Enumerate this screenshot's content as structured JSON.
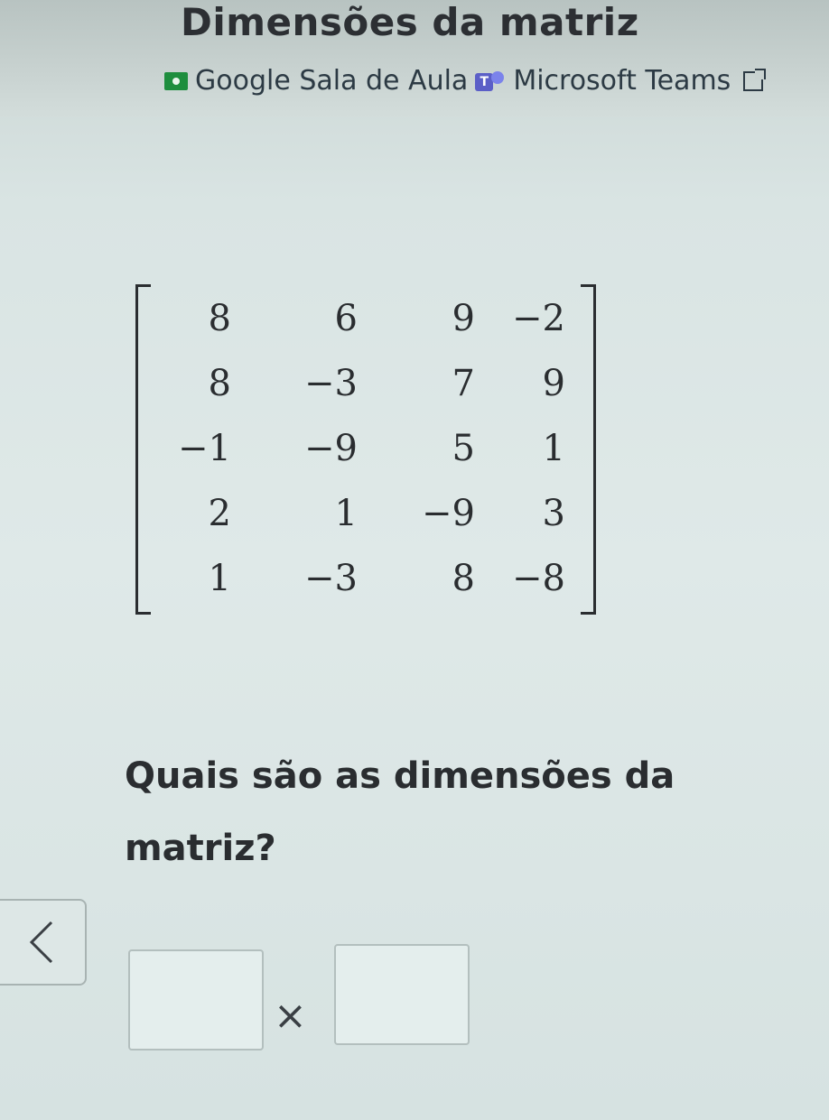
{
  "header": {
    "title": "Dimensões da matriz",
    "links": [
      {
        "label": "Google Sala de Aula",
        "icon": "google-classroom-icon"
      },
      {
        "label": "Microsoft Teams",
        "icon": "microsoft-teams-icon"
      }
    ],
    "external_icon": "external-link-icon"
  },
  "matrix": {
    "rows": [
      [
        "8",
        "6",
        "9",
        "−2"
      ],
      [
        "8",
        "−3",
        "7",
        "9"
      ],
      [
        "−1",
        "−9",
        "5",
        "1"
      ],
      [
        "2",
        "1",
        "−9",
        "3"
      ],
      [
        "1",
        "−3",
        "8",
        "−8"
      ]
    ]
  },
  "question": {
    "text": "Quais são as dimensões da matriz?"
  },
  "answer": {
    "rows_value": "",
    "cols_value": "",
    "times_symbol": "×"
  },
  "navigation": {
    "back_icon": "chevron-left-icon"
  }
}
